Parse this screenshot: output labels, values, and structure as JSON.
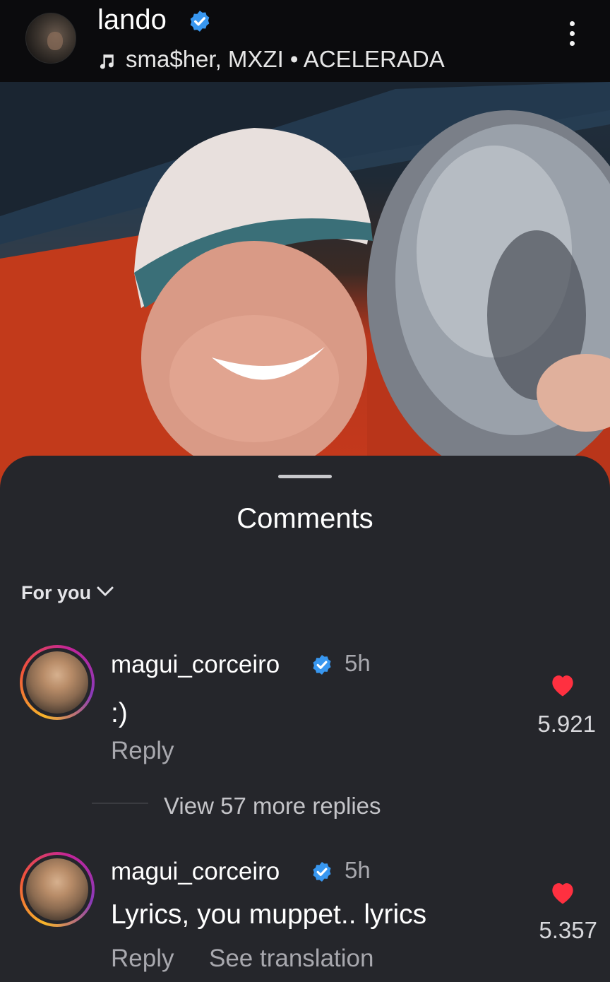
{
  "header": {
    "username": "lando",
    "verified": true,
    "music": "sma$her, MXZI • ACELERADA",
    "more_icon": "more-vertical-icon"
  },
  "photo": {
    "alt": "lando-selfie-photo"
  },
  "comments_sheet": {
    "title": "Comments",
    "filter_label": "For you",
    "filter_icon": "chevron-down-icon",
    "view_replies": "View 57 more replies",
    "comments": [
      {
        "username": "magui_corceiro",
        "verified": true,
        "time": "5h",
        "text": ":)",
        "reply_label": "Reply",
        "likes": "5.921"
      },
      {
        "username": "magui_corceiro",
        "verified": true,
        "time": "5h",
        "text": "Lyrics, you muppet.. lyrics",
        "reply_label": "Reply",
        "translate_label": "See translation",
        "likes": "5.357"
      }
    ]
  },
  "colors": {
    "sheet_bg": "#25262b",
    "header_bg": "#0b0b0d",
    "verified_blue": "#3897f0",
    "heart_red": "#ff3040",
    "muted_text": "#a8a8ae"
  }
}
